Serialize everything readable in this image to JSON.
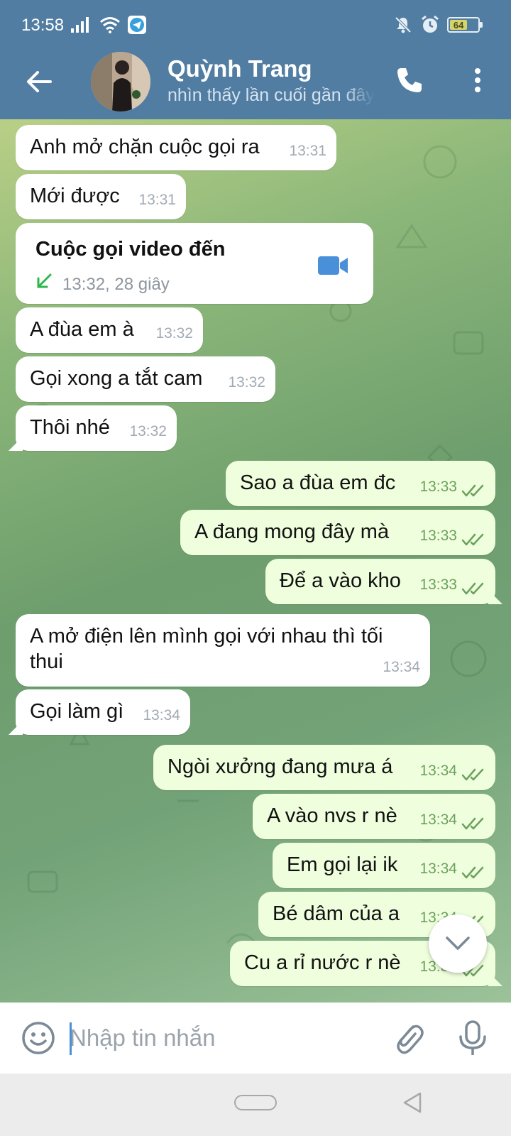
{
  "status_bar": {
    "time": "13:58",
    "battery_level": "64",
    "battery_fraction": 0.64,
    "left_icons": [
      "signal-icon",
      "wifi-icon",
      "telegram-icon"
    ],
    "right_icons": [
      "silent-icon",
      "alarm-icon",
      "battery-icon"
    ]
  },
  "header": {
    "contact_name": "Quỳnh Trang",
    "contact_status": "nhìn thấy lần cuối gần đây",
    "icons": [
      "back-arrow-icon",
      "phone-icon",
      "more-vertical-icon"
    ],
    "color": "#517da2"
  },
  "messages": [
    {
      "dir": "in",
      "text": "Anh mở chặn cuộc gọi ra",
      "time": "13:31"
    },
    {
      "dir": "in",
      "text": "Mới được",
      "time": "13:31"
    },
    {
      "dir": "in",
      "type": "call",
      "title": "Cuộc gọi video đến",
      "meta": "13:32, 28 giây"
    },
    {
      "dir": "in",
      "text": "A đùa em à",
      "time": "13:32"
    },
    {
      "dir": "in",
      "text": "Gọi xong a tắt cam",
      "time": "13:32"
    },
    {
      "dir": "in",
      "text": "Thôi nhé",
      "time": "13:32"
    },
    {
      "dir": "out",
      "text": "Sao a đùa em đc",
      "time": "13:33",
      "read": true
    },
    {
      "dir": "out",
      "text": "A đang mong đây mà",
      "time": "13:33",
      "read": true
    },
    {
      "dir": "out",
      "text": "Để a vào kho",
      "time": "13:33",
      "read": true
    },
    {
      "dir": "in",
      "text": "A mở điện lên mình gọi với nhau thì tối",
      "text2": "thui",
      "time": "13:34"
    },
    {
      "dir": "in",
      "text": "Gọi làm gì",
      "time": "13:34"
    },
    {
      "dir": "out",
      "text": "Ngòi xưởng đang mưa á",
      "time": "13:34",
      "read": true
    },
    {
      "dir": "out",
      "text": "A vào nvs r nè",
      "time": "13:34",
      "read": true
    },
    {
      "dir": "out",
      "text": "Em gọi lại ik",
      "time": "13:34",
      "read": true
    },
    {
      "dir": "out",
      "text": "Bé dâm của a",
      "time": "13:34",
      "read": true
    },
    {
      "dir": "out",
      "text": "Cu a rỉ nước r nè",
      "time": "13:35",
      "read": true
    }
  ],
  "input_bar": {
    "placeholder": "Nhập tin nhắn",
    "icons": [
      "emoji-icon",
      "attach-icon",
      "mic-icon"
    ]
  },
  "colors": {
    "incoming_bubble": "#ffffff",
    "outgoing_bubble": "#effedd",
    "outgoing_time": "#6ba15c",
    "video_icon": "#4a90d9",
    "incoming_call_arrow": "#2eb84b"
  }
}
